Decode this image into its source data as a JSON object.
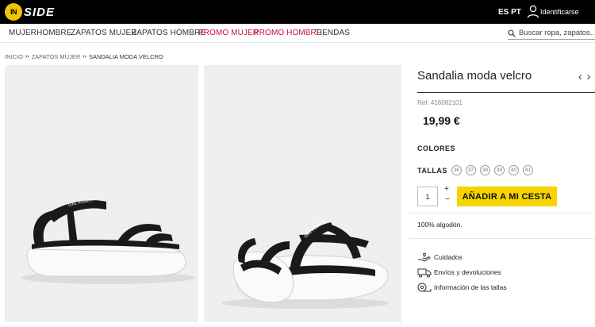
{
  "header": {
    "logo_badge": "IN",
    "logo_text": "SIDE",
    "lang": "ES PT",
    "user_label": "Identificarse"
  },
  "nav": {
    "items": [
      {
        "label": "MUJER",
        "promo": false
      },
      {
        "label": "HOMBRE",
        "promo": false
      },
      {
        "label": "ZAPATOS MUJER",
        "promo": false
      },
      {
        "label": "ZAPATOS HOMBRE",
        "promo": false
      },
      {
        "label": "PROMO MUJER",
        "promo": true
      },
      {
        "label": "PROMO HOMBRE",
        "promo": true
      },
      {
        "label": "TIENDAS",
        "promo": false
      }
    ],
    "search_placeholder": "Buscar ropa, zapatos..."
  },
  "breadcrumb": {
    "items": [
      "INICIO",
      "ZAPATOS MUJER",
      "SANDALIA MODA VELCRO"
    ],
    "separator": "››"
  },
  "product": {
    "title": "Sandalia moda velcro",
    "prev_arrow": "‹",
    "next_arrow": "›",
    "ref": "Ref. 416082101",
    "price": "19,99 €",
    "colors_label": "COLORES",
    "sizes_label": "TALLAS",
    "sizes": [
      "36",
      "37",
      "38",
      "39",
      "40",
      "41"
    ],
    "quantity": "1",
    "plus": "+",
    "minus": "−",
    "add_to_cart": "AÑADIR A MI CESTA",
    "material": "100% algodón.",
    "strap_text": "GIRL POWER",
    "info": {
      "care": "Cuidados",
      "shipping": "Envíos y devoluciones",
      "size_info": "Información de las tallas"
    }
  },
  "colors": {
    "topbar": "#000000",
    "accent": "#f6d400",
    "promo": "#c8102e"
  }
}
